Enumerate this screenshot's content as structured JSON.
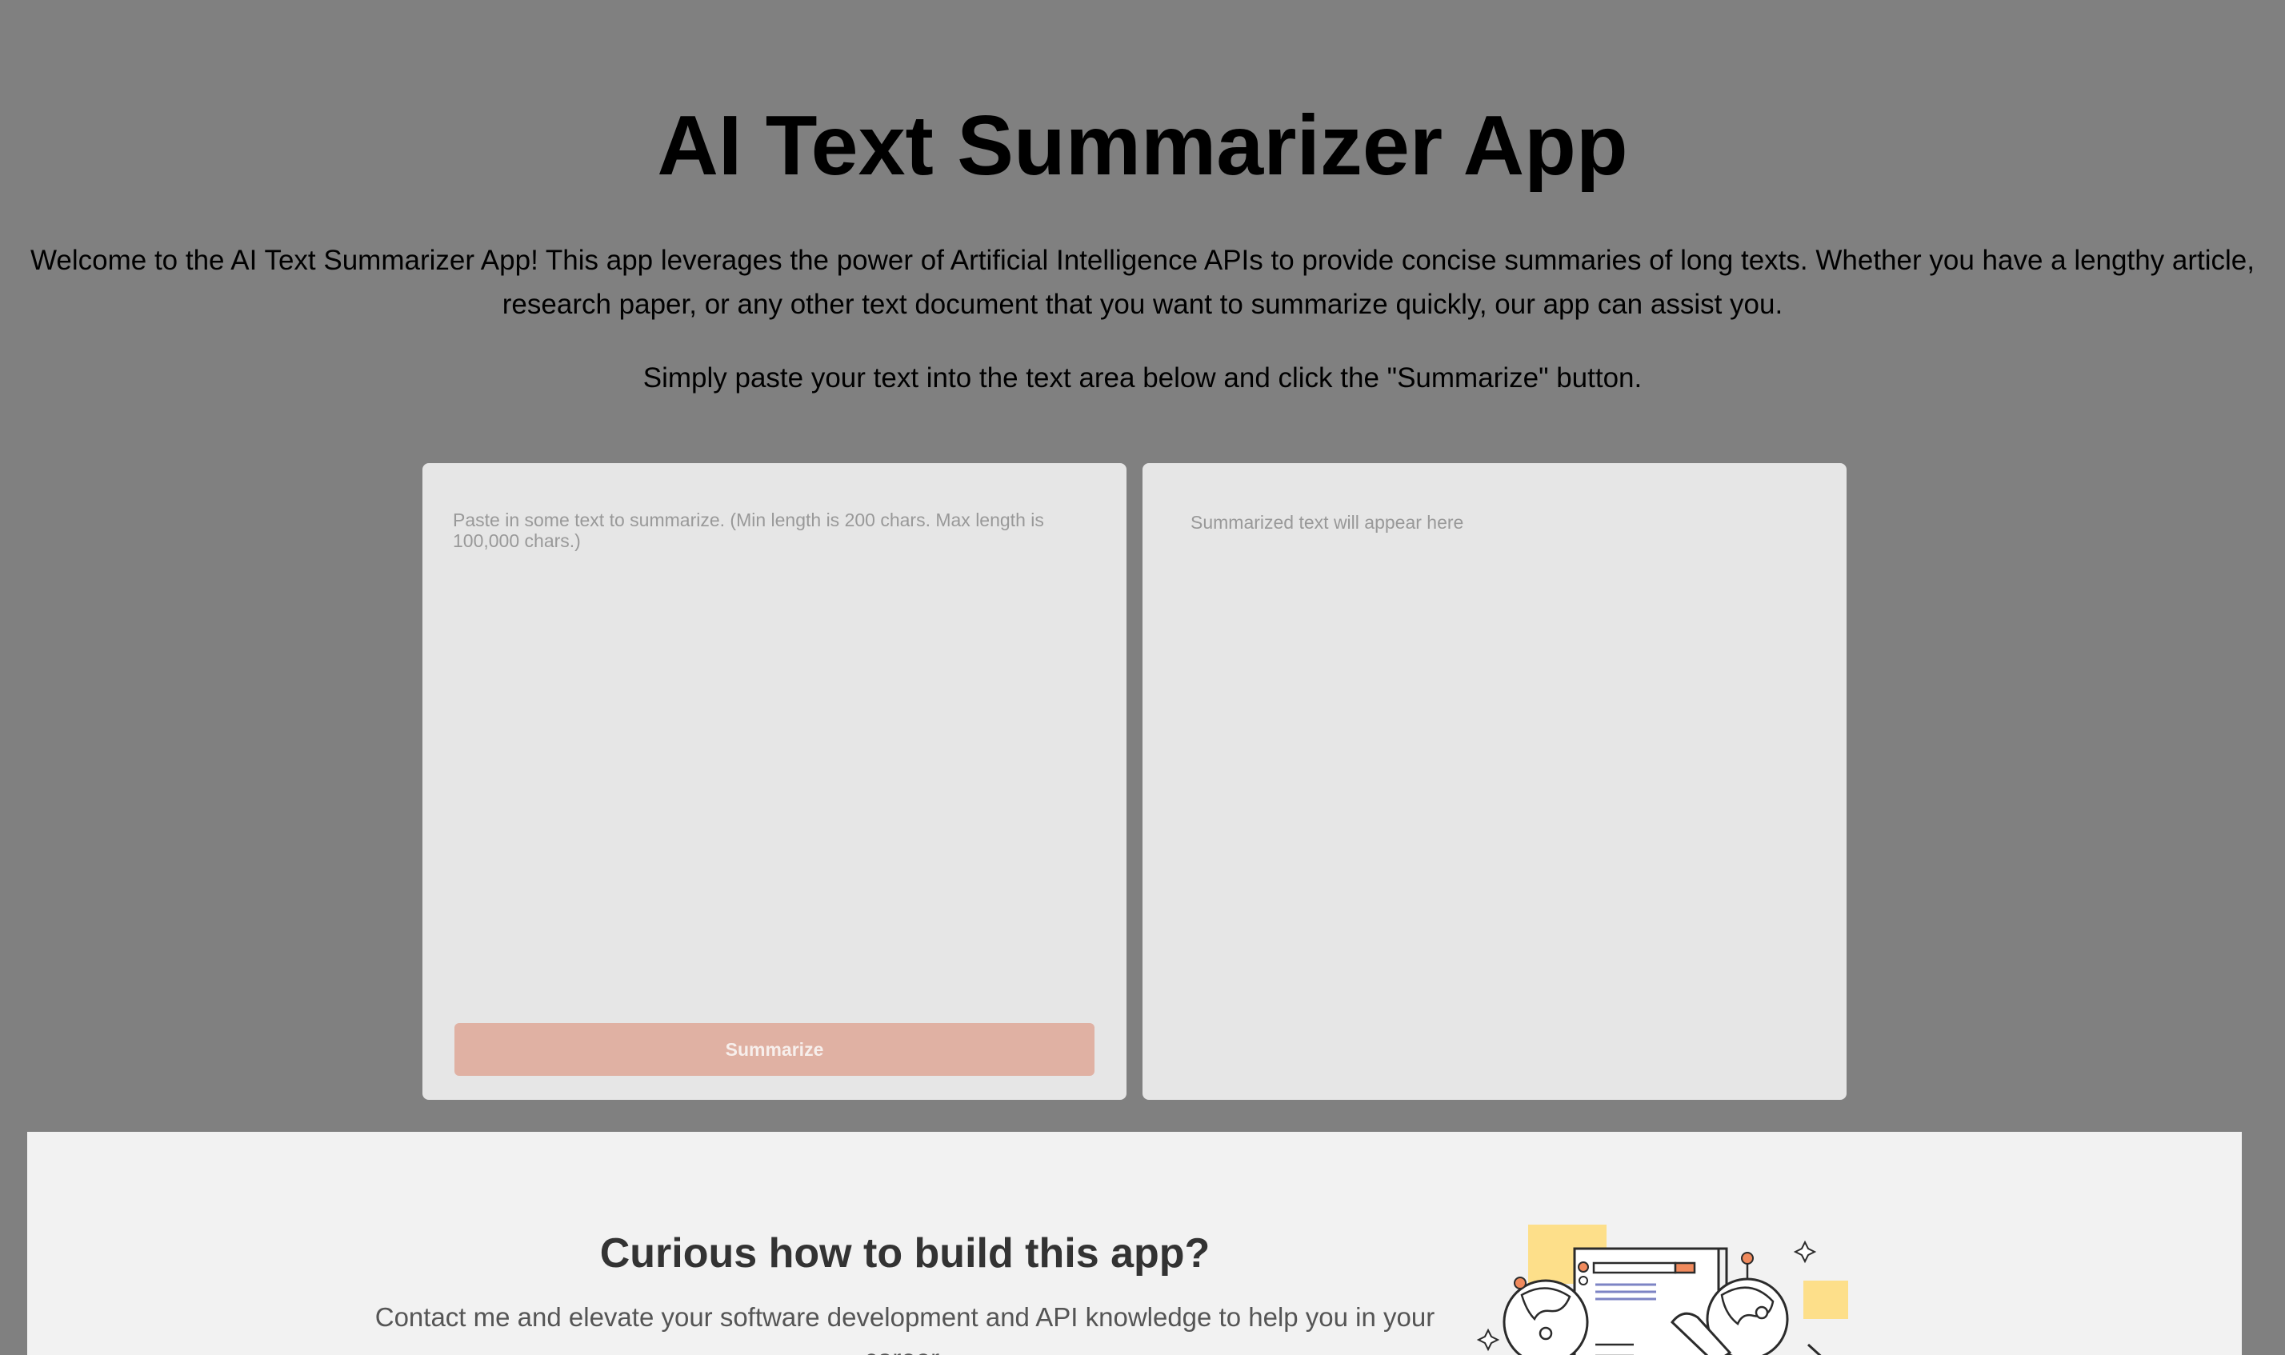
{
  "header": {
    "title": "AI Text Summarizer App",
    "intro": "Welcome to the AI Text Summarizer App! This app leverages the power of Artificial Intelligence APIs to provide concise summaries of long texts. Whether you have a lengthy article, research paper, or any other text document that you want to summarize quickly, our app can assist you.",
    "instruction": "Simply paste your text into the text area below and click the \"Summarize\" button."
  },
  "input_panel": {
    "placeholder": "Paste in some text to summarize. (Min length is 200 chars. Max length is 100,000 chars.)",
    "value": "",
    "button_label": "Summarize",
    "button_disabled": true
  },
  "output_panel": {
    "placeholder": "Summarized text will appear here"
  },
  "cta": {
    "title": "Curious how to build this app?",
    "text": "Contact me and elevate your software development and API knowledge to help you in your career.",
    "illustration_icon": "people-reading-document-illustration"
  },
  "colors": {
    "background": "#808080",
    "panel": "#e6e6e6",
    "button": "#e0b1a3",
    "cta_background": "#f2f2f2",
    "accent_yellow": "#fddf8a",
    "accent_orange": "#f08a5d"
  }
}
